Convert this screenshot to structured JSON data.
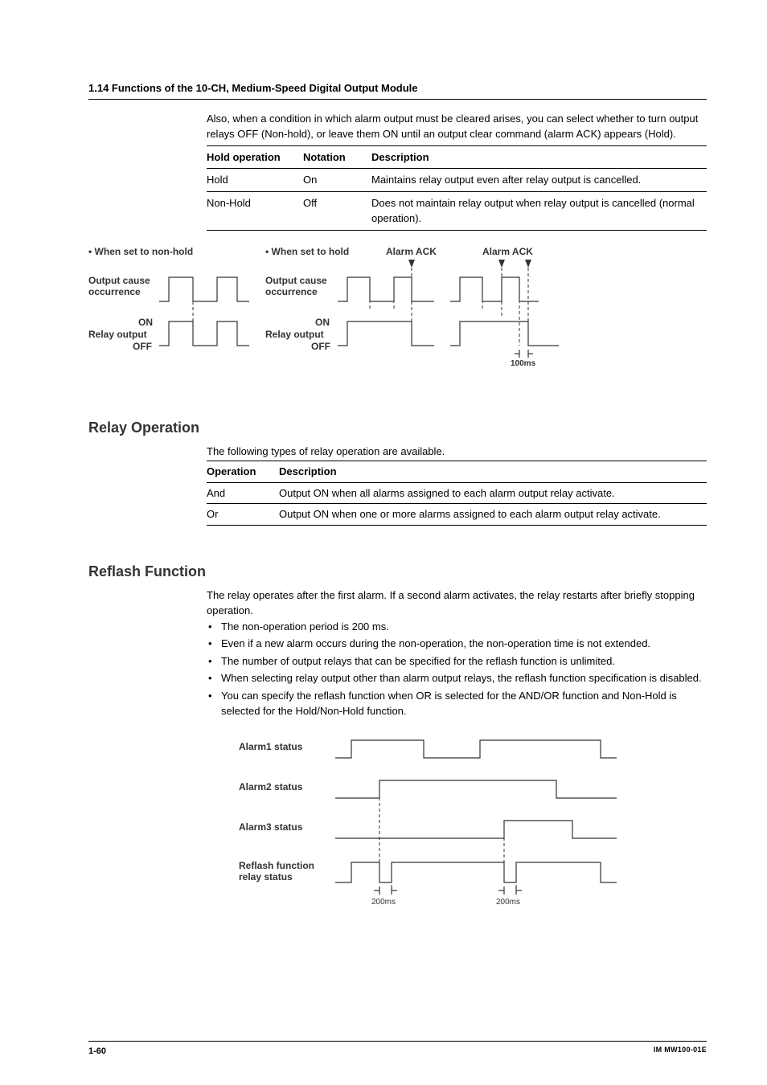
{
  "header": {
    "title": "1.14  Functions of the 10-CH, Medium-Speed Digital Output Module"
  },
  "intro": "Also, when a condition in which alarm output must be cleared arises, you can select whether to turn output relays OFF (Non-hold), or leave them ON until an output clear command (alarm ACK) appears (Hold).",
  "holdTable": {
    "headers": {
      "c1": "Hold operation",
      "c2": "Notation",
      "c3": "Description"
    },
    "rows": [
      {
        "c1": "Hold",
        "c2": "On",
        "c3": "Maintains relay output even after relay output is cancelled."
      },
      {
        "c1": "Non-Hold",
        "c2": "Off",
        "c3": "Does not maintain relay output when relay output is cancelled (normal operation)."
      }
    ]
  },
  "diag1": {
    "title_nonhold": "• When set to non-hold",
    "title_hold": "• When set to hold",
    "alarm_ack": "Alarm ACK",
    "output_cause1": "Output cause",
    "output_cause2": "occurrence",
    "on": "ON",
    "off": "OFF",
    "relay_output": "Relay output",
    "ms100": "100ms"
  },
  "relayOp": {
    "heading": "Relay Operation",
    "intro": "The following types of relay operation are available.",
    "headers": {
      "c1": "Operation",
      "c2": "Description"
    },
    "rows": [
      {
        "c1": "And",
        "c2": "Output ON when all alarms assigned to each alarm output relay activate."
      },
      {
        "c1": "Or",
        "c2": "Output ON when one or more alarms assigned to each alarm output relay activate."
      }
    ]
  },
  "reflash": {
    "heading": "Reflash Function",
    "intro": "The relay operates after the first alarm. If a second alarm activates, the relay restarts after briefly stopping operation.",
    "bullets": [
      "The non-operation period is 200 ms.",
      "Even if a new alarm occurs during the non-operation, the non-operation time is not extended.",
      "The number of output relays that can be specified for the reflash function is unlimited.",
      "When selecting relay output other than alarm output relays, the reflash function specification is disabled.",
      "You can specify the reflash function when OR is selected for the AND/OR function and Non-Hold is selected for the Hold/Non-Hold function."
    ],
    "diag": {
      "a1": "Alarm1 status",
      "a2": "Alarm2 status",
      "a3": "Alarm3 status",
      "rf1": "Reflash function",
      "rf2": "relay status",
      "ms200": "200ms"
    }
  },
  "footer": {
    "page": "1-60",
    "docid": "IM MW100-01E"
  }
}
